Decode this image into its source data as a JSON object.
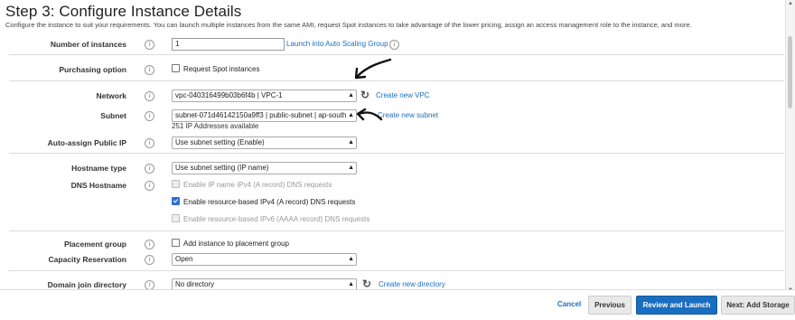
{
  "header": {
    "title": "Step 3: Configure Instance Details",
    "description": "Configure the instance to suit your requirements. You can launch multiple instances from the same AMI, request Spot instances to take advantage of the lower pricing, assign an access management role to the instance, and more."
  },
  "fields": {
    "instances": {
      "label": "Number of instances",
      "value": "1",
      "link": "Launch into Auto Scaling Group"
    },
    "purchasing": {
      "label": "Purchasing option",
      "checkbox": "Request Spot instances"
    },
    "network": {
      "label": "Network",
      "value": "vpc-040316499b03b6f4b | VPC-1",
      "link": "Create new VPC"
    },
    "subnet": {
      "label": "Subnet",
      "value": "subnet-071d46142150a9ff3 | public-subnet | ap-south",
      "link": "Create new subnet",
      "note": "251 IP Addresses available"
    },
    "public_ip": {
      "label": "Auto-assign Public IP",
      "value": "Use subnet setting (Enable)"
    },
    "hostname": {
      "label": "Hostname type",
      "value": "Use subnet setting (IP name)"
    },
    "dns": {
      "label": "DNS Hostname",
      "opt1": "Enable IP name IPv4 (A record) DNS requests",
      "opt2": "Enable resource-based IPv4 (A record) DNS requests",
      "opt3": "Enable resource-based IPv6 (AAAA record) DNS requests"
    },
    "placement": {
      "label": "Placement group",
      "checkbox": "Add instance to placement group"
    },
    "capacity": {
      "label": "Capacity Reservation",
      "value": "Open"
    },
    "domain": {
      "label": "Domain join directory",
      "value": "No directory",
      "link": "Create new directory"
    }
  },
  "info_glyph": "i",
  "footer": {
    "cancel": "Cancel",
    "previous": "Previous",
    "review": "Review and Launch",
    "next": "Next: Add Storage"
  },
  "colors": {
    "link": "#1a6ec0",
    "primary": "#1a6ec0"
  }
}
